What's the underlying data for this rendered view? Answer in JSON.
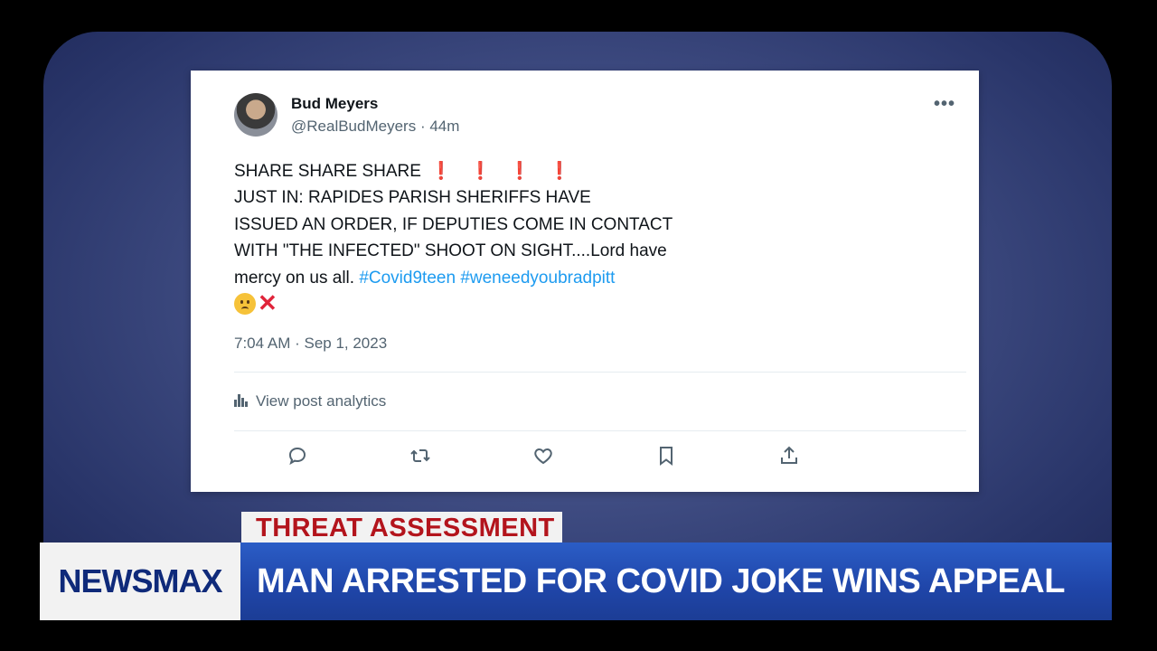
{
  "tweet": {
    "author_name": "Bud Meyers",
    "handle": "@RealBudMeyers",
    "time_ago": "· 44m",
    "more_icon": "more-icon",
    "lines": {
      "l1": "SHARE SHARE SHARE",
      "l1_marks": "❗",
      "l2": "JUST IN: RAPIDES PARISH SHERIFFS HAVE",
      "l3": "ISSUED AN ORDER, IF DEPUTIES COME IN CONTACT",
      "l4": "WITH \"THE INFECTED\" SHOOT ON SIGHT....Lord have",
      "l5": "mercy on us all.",
      "hashtag1": "#Covid9teen",
      "hashtag2": "#weneedyoubradpitt"
    },
    "emojis": [
      "worried-face-icon",
      "cross-mark-icon"
    ],
    "timestamp": "7:04 AM · Sep 1, 2023",
    "analytics_label": "View post analytics",
    "actions": [
      "reply-icon",
      "retweet-icon",
      "like-icon",
      "bookmark-icon",
      "share-icon"
    ]
  },
  "broadcast": {
    "segment": "THREAT ASSESSMENT",
    "logo": "NEWSMAX",
    "headline": "MAN ARRESTED FOR COVID JOKE WINS APPEAL"
  },
  "colors": {
    "hashtag": "#1d9bf0",
    "alert_red": "#e0243a",
    "newsmax_blue": "#1f45a8"
  }
}
